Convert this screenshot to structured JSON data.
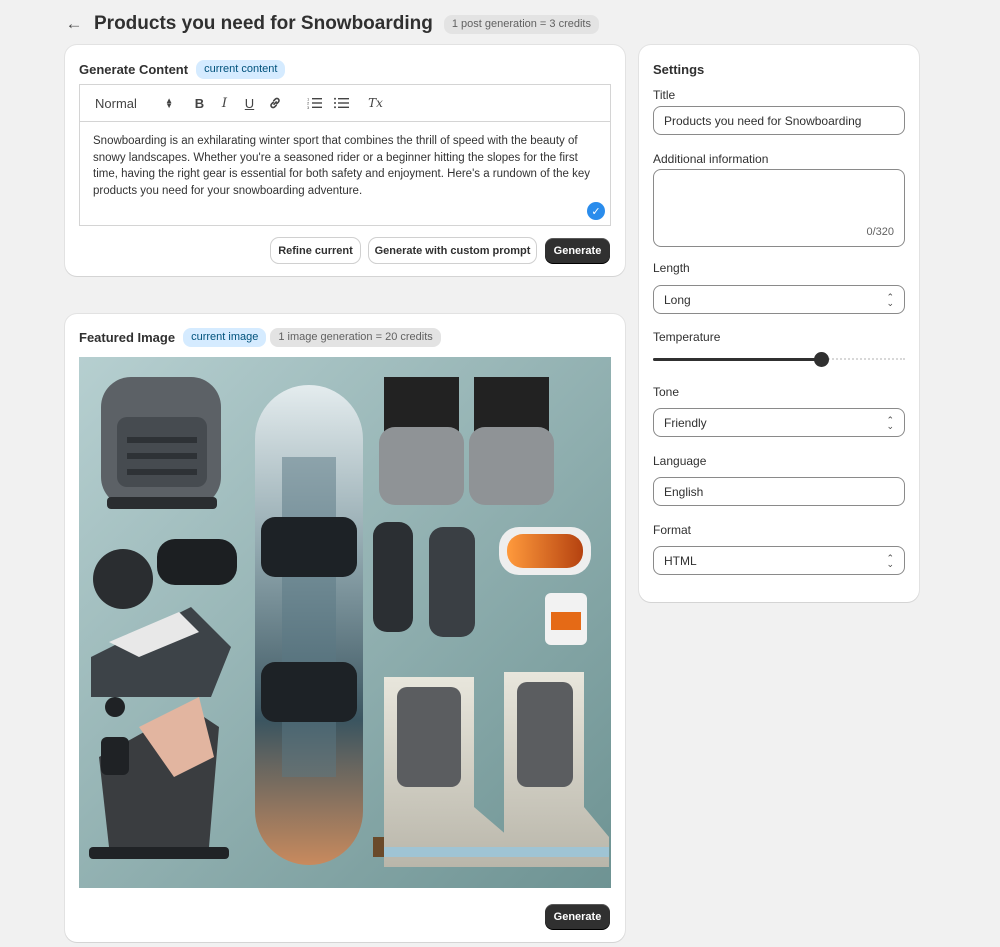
{
  "header": {
    "title": "Products you need for Snowboarding",
    "credits_badge": "1 post generation = 3 credits"
  },
  "content_card": {
    "title": "Generate Content",
    "badge": "current content",
    "toolbar": {
      "block_style": "Normal",
      "bold": "B",
      "italic": "I",
      "underline": "U",
      "clear_format": "Tx"
    },
    "body": "Snowboarding is an exhilarating winter sport that combines the thrill of speed with the beauty of snowy landscapes. Whether you're a seasoned rider or a beginner hitting the slopes for the first time, having the right gear is essential for both safety and enjoyment. Here's a rundown of the key products you need for your snowboarding adventure.",
    "buttons": {
      "refine": "Refine current",
      "custom": "Generate with custom prompt",
      "generate": "Generate"
    }
  },
  "image_card": {
    "title": "Featured Image",
    "badge": "current image",
    "credits_badge": "1 image generation = 20 credits",
    "generate": "Generate"
  },
  "settings": {
    "heading": "Settings",
    "title_label": "Title",
    "title_value": "Products you need for Snowboarding",
    "additional_label": "Additional information",
    "additional_value": "",
    "additional_counter": "0/320",
    "length_label": "Length",
    "length_value": "Long",
    "temperature_label": "Temperature",
    "temperature_fraction": 0.68,
    "tone_label": "Tone",
    "tone_value": "Friendly",
    "language_label": "Language",
    "language_value": "English",
    "format_label": "Format",
    "format_value": "HTML"
  },
  "colors": {
    "primary_button": "#303030",
    "badge_blue": "#d5ebff",
    "check_blue": "#2a8cec"
  }
}
